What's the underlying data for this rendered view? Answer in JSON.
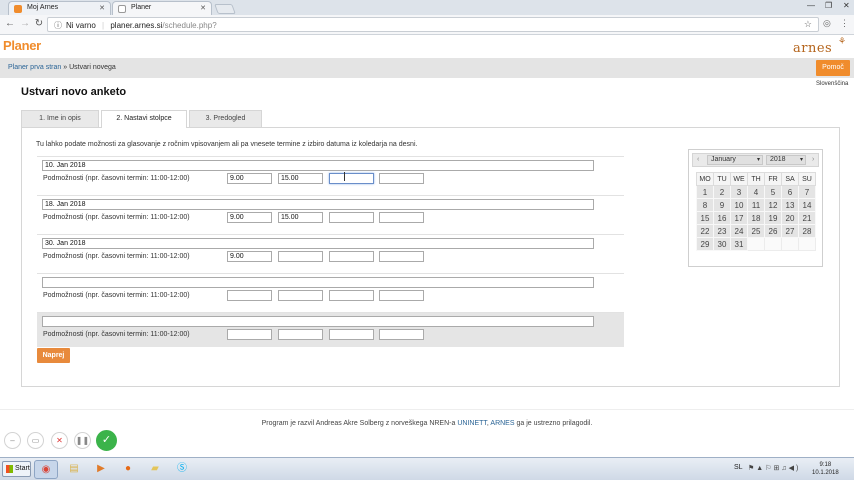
{
  "browser": {
    "tabs": [
      {
        "title": "Moj Arnes",
        "active": false
      },
      {
        "title": "Planer",
        "active": true
      }
    ],
    "security_label": "Ni varno",
    "url_host": "planer.arnes.si",
    "url_path": "/schedule.php?"
  },
  "header": {
    "brand": "Planer",
    "partner_logo": "arnes",
    "breadcrumb_root": "Planer prva stran",
    "breadcrumb_sep": " » ",
    "breadcrumb_current": "Ustvari novega",
    "help_label": "Pomoč",
    "language": "Slovenščina"
  },
  "page": {
    "title": "Ustvari novo anketo",
    "tabs": [
      {
        "label": "1. Ime in opis"
      },
      {
        "label": "2. Nastavi stolpce"
      },
      {
        "label": "3. Predogled"
      }
    ],
    "intro": "Tu lahko podate možnosti za glasovanje z ročnim vpisovanjem ali pa vnesete termine z izbiro datuma iz koledarja na desni.",
    "option_label": "Podmožnosti (npr. časovni termin: 11:00-12:00)",
    "rows": [
      {
        "date": "10. Jan 2018",
        "slots": [
          "9.00",
          "15.00",
          "",
          ""
        ]
      },
      {
        "date": "18. Jan 2018",
        "slots": [
          "9.00",
          "15.00",
          "",
          ""
        ]
      },
      {
        "date": "30. Jan 2018",
        "slots": [
          "9.00",
          "",
          "",
          ""
        ]
      },
      {
        "date": "",
        "slots": [
          "",
          "",
          "",
          ""
        ]
      },
      {
        "date": "",
        "slots": [
          "",
          "",
          "",
          ""
        ]
      }
    ],
    "next_label": "Naprej"
  },
  "calendar": {
    "month": "January",
    "year": "2018",
    "weekdays": [
      "MO",
      "TU",
      "WE",
      "TH",
      "FR",
      "SA",
      "SU"
    ],
    "weeks": [
      [
        "1",
        "2",
        "3",
        "4",
        "5",
        "6",
        "7"
      ],
      [
        "8",
        "9",
        "10",
        "11",
        "12",
        "13",
        "14"
      ],
      [
        "15",
        "16",
        "17",
        "18",
        "19",
        "20",
        "21"
      ],
      [
        "22",
        "23",
        "24",
        "25",
        "26",
        "27",
        "28"
      ],
      [
        "29",
        "30",
        "31",
        "",
        "",
        "",
        ""
      ]
    ]
  },
  "footer": {
    "text_before": "Program je razvil Andreas Akre Solberg z norveškega NREN-a ",
    "link1": "UNINETT",
    "text_mid": ", ",
    "link2": "ARNES",
    "text_after": " ga je ustrezno prilagodil."
  },
  "taskbar": {
    "start_label": "Start",
    "language": "SL",
    "time": "9:18",
    "date": "10.1.2018"
  },
  "colors": {
    "accent": "#f08c2c",
    "link": "#2a6496",
    "confirm": "#3bb34a"
  }
}
